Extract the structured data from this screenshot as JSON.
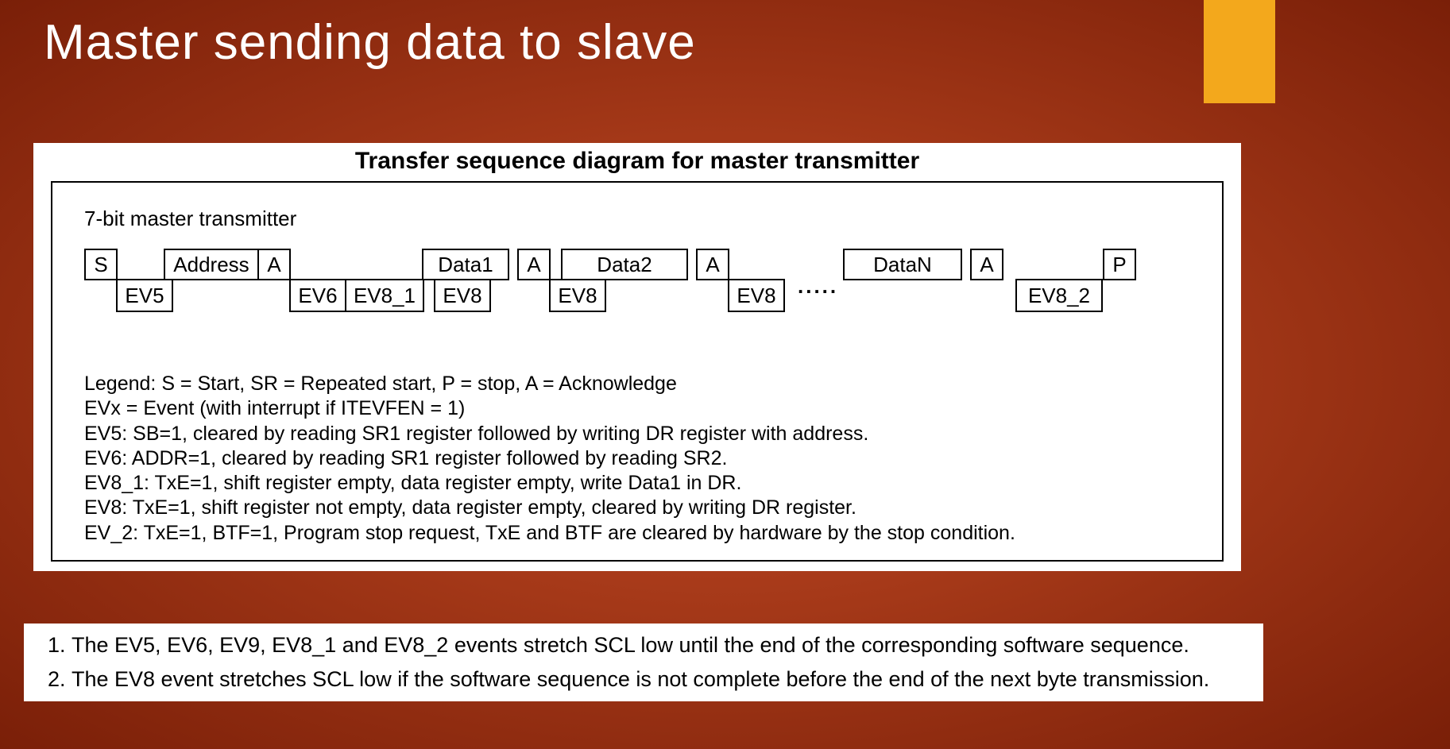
{
  "slide": {
    "title": "Master sending data to slave"
  },
  "diagram": {
    "title": "Transfer sequence diagram for master transmitter",
    "subhead": "7-bit master transmitter",
    "top": {
      "s": "S",
      "address": "Address",
      "a1": "A",
      "data1": "Data1",
      "a2": "A",
      "data2": "Data2",
      "a3": "A",
      "datan": "DataN",
      "a4": "A",
      "p": "P"
    },
    "bottom": {
      "ev5": "EV5",
      "ev6": "EV6",
      "ev8_1": "EV8_1",
      "ev8a": "EV8",
      "ev8b": "EV8",
      "ev8c": "EV8",
      "ev8_2": "EV8_2"
    },
    "dots": ".....",
    "legend": {
      "l1": "Legend: S = Start, SR = Repeated start, P = stop, A = Acknowledge",
      "l2": "EVx = Event (with interrupt if ITEVFEN = 1)",
      "l3": "EV5: SB=1, cleared by reading SR1 register followed by writing DR register with address.",
      "l4": "EV6: ADDR=1, cleared by reading SR1 register followed by reading SR2.",
      "l5": "EV8_1: TxE=1, shift register empty, data register empty, write Data1 in DR.",
      "l6": "EV8: TxE=1, shift register not empty, data register empty, cleared by writing DR register.",
      "l7": "EV_2: TxE=1, BTF=1, Program stop request, TxE and BTF are cleared by hardware by the stop condition."
    }
  },
  "notes": {
    "n1": "The EV5, EV6, EV9, EV8_1 and EV8_2 events stretch SCL low until the end of the corresponding software sequence.",
    "n2": "The EV8 event stretches SCL low if the software sequence is not complete before the end of the next byte transmission."
  }
}
